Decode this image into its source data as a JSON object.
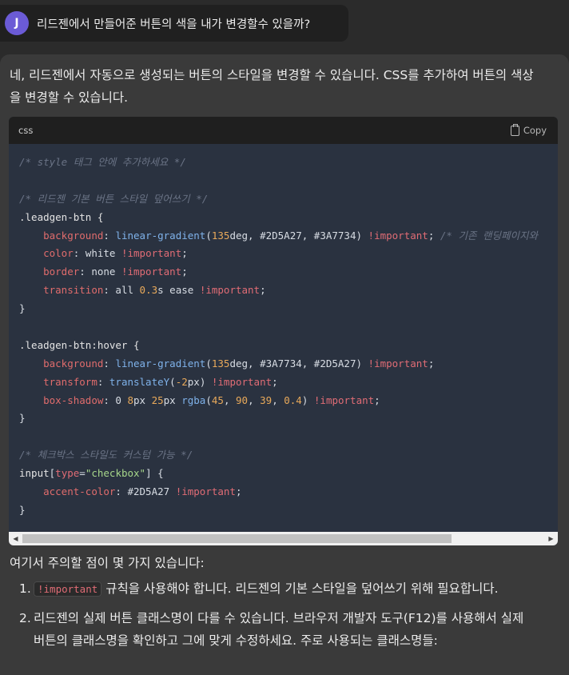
{
  "user": {
    "avatar_initial": "J",
    "message": "리드젠에서 만들어준 버튼의 색을 내가 변경할수 있을까?"
  },
  "response": {
    "intro": "네, 리드젠에서 자동으로 생성되는 버튼의 스타일을 변경할 수 있습니다. CSS를 추가하여 버튼의 색상을 변경할 수 있습니다.",
    "code": {
      "language": "css",
      "copy_label": "Copy",
      "comment_1": "/* style 태그 안에 추가하세요 */",
      "comment_2": "/* 리드젠 기본 버튼 스타일 덮어쓰기 */",
      "selector_1": ".leadgen-btn {",
      "bg_1_prop": "background",
      "bg_1_func": "linear-gradient",
      "bg_1_num": "135",
      "bg_1_rest": "deg, #2D5A27, #3A7734)",
      "important": "!important",
      "bg_1_comment": "/* 기존 랜딩페이지와 ",
      "color_prop": "color",
      "color_val": " white ",
      "border_prop": "border",
      "border_val": " none ",
      "transition_prop": "transition",
      "transition_val_a": " all ",
      "transition_num": "0.3",
      "transition_val_b": "s ease ",
      "close_brace": "}",
      "selector_2": ".leadgen-btn:hover {",
      "bg_2_prop": "background",
      "bg_2_func": "linear-gradient",
      "bg_2_num": "135",
      "bg_2_rest": "deg, #3A7734, #2D5A27)",
      "transform_prop": "transform",
      "transform_func": "translateY",
      "transform_num": "-2",
      "transform_rest": "px)",
      "shadow_prop": "box-shadow",
      "shadow_val_a": " 0 ",
      "shadow_num_a": "8",
      "shadow_val_b": "px ",
      "shadow_num_b": "25",
      "shadow_val_c": "px ",
      "shadow_func": "rgba",
      "shadow_num_r": "45",
      "shadow_num_g": "90",
      "shadow_num_b2": "39",
      "shadow_num_a2": "0.4",
      "comment_3": "/* 체크박스 스타일도 커스텀 가능 */",
      "selector_3_a": "input",
      "selector_3_attr": "type",
      "selector_3_str": "\"checkbox\"",
      "accent_prop": "accent-color",
      "accent_val": " #2D5A27 "
    },
    "note": "여기서 주의할 점이 몇 가지 있습니다:",
    "list": [
      {
        "num": "1.",
        "code": "!important",
        "text": " 규칙을 사용해야 합니다. 리드젠의 기본 스타일을 덮어쓰기 위해 필요합니다."
      },
      {
        "num": "2.",
        "text": "리드젠의 실제 버튼 클래스명이 다를 수 있습니다. 브라우저 개발자 도구(F12)를 사용해서 실제 버튼의 클래스명을 확인하고 그에 맞게 수정하세요. 주로 사용되는 클래스명들:"
      }
    ]
  }
}
